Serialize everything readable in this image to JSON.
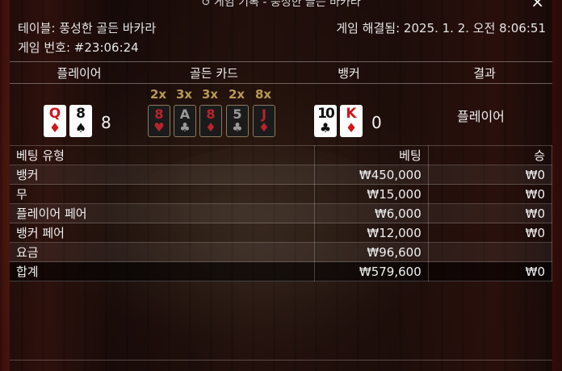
{
  "window": {
    "title": "게임 기록 - 풍성한 골든 바카라",
    "close_icon": "×"
  },
  "info": {
    "table_label": "테이블: 풍성한 골든 바카라",
    "game_number_label": "게임 번호: #23:06:24",
    "resolved_label": "게임 해결됨: 2025. 1. 2. 오전 8:06:51"
  },
  "columns": {
    "player": "플레이어",
    "golden_cards": "골든 카드",
    "banker": "뱅커",
    "result": "결과"
  },
  "player_hand": {
    "cards": [
      {
        "rank": "Q",
        "suit": "♦",
        "color": "red"
      },
      {
        "rank": "8",
        "suit": "♠",
        "color": "black"
      }
    ],
    "score": "8"
  },
  "golden_cards": [
    {
      "multiplier": "2x",
      "rank": "8",
      "suit": "♥",
      "color": "red"
    },
    {
      "multiplier": "3x",
      "rank": "A",
      "suit": "♣",
      "color": "grey"
    },
    {
      "multiplier": "3x",
      "rank": "8",
      "suit": "♦",
      "color": "red"
    },
    {
      "multiplier": "2x",
      "rank": "5",
      "suit": "♣",
      "color": "grey"
    },
    {
      "multiplier": "8x",
      "rank": "J",
      "suit": "♦",
      "color": "red"
    }
  ],
  "banker_hand": {
    "cards": [
      {
        "rank": "10",
        "suit": "♣",
        "color": "black"
      },
      {
        "rank": "K",
        "suit": "♦",
        "color": "red"
      }
    ],
    "score": "0"
  },
  "result": "플레이어",
  "bets_table": {
    "headers": {
      "type": "베팅 유형",
      "bet": "베팅",
      "win": "승"
    },
    "rows": [
      {
        "type": "뱅커",
        "bet": "₩450,000",
        "win": "₩0"
      },
      {
        "type": "무",
        "bet": "₩15,000",
        "win": "₩0"
      },
      {
        "type": "플레이어 페어",
        "bet": "₩6,000",
        "win": "₩0"
      },
      {
        "type": "뱅커 페어",
        "bet": "₩12,000",
        "win": "₩0"
      },
      {
        "type": "요금",
        "bet": "₩96,600",
        "win": ""
      }
    ],
    "total": {
      "type": "합계",
      "bet": "₩579,600",
      "win": "₩0"
    }
  },
  "colors": {
    "card_red": "#d3141c",
    "multiplier_gold": "#b89a55"
  }
}
